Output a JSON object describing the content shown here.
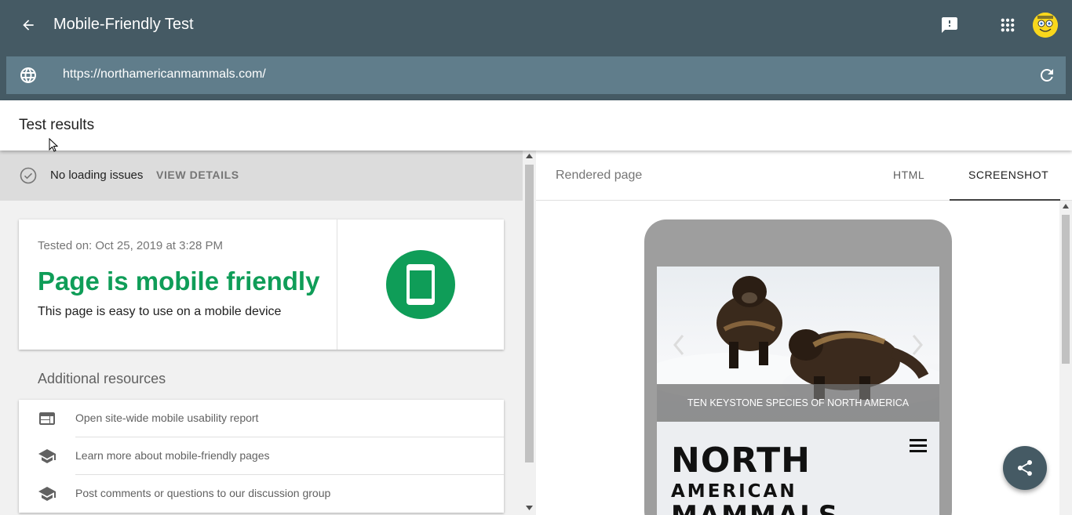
{
  "header": {
    "title": "Mobile-Friendly Test",
    "url": "https://northamericanmammals.com/",
    "icons": [
      "arrow-back-icon",
      "feedback-icon",
      "apps-grid-icon",
      "account-avatar",
      "globe-icon",
      "reload-icon"
    ]
  },
  "results": {
    "title": "Test results"
  },
  "loading": {
    "status": "No loading issues",
    "view_details": "VIEW DETAILS"
  },
  "card": {
    "tested_on": "Tested on: Oct 25, 2019 at 3:28 PM",
    "verdict": "Page is mobile friendly",
    "subtitle": "This page is easy to use on a mobile device",
    "accent": "#0f9d58"
  },
  "resources": {
    "title": "Additional resources",
    "items": [
      {
        "label": "Open site-wide mobile usability report",
        "icon": "web-icon"
      },
      {
        "label": "Learn more about mobile-friendly pages",
        "icon": "school-icon"
      },
      {
        "label": "Post comments or questions to our discussion group",
        "icon": "school-icon"
      }
    ]
  },
  "right": {
    "rendered_label": "Rendered page",
    "tab_html": "HTML",
    "tab_screenshot": "SCREENSHOT",
    "active_tab": "SCREENSHOT"
  },
  "preview": {
    "caption": "TEN KEYSTONE SPECIES OF NORTH AMERICA",
    "logo_line1": "NORTH",
    "logo_line2": "AMERICAN",
    "logo_line3": "MAMMALS"
  },
  "colors": {
    "appbar": "#455a64",
    "urlbar": "#607d8b",
    "success": "#0f9d58"
  }
}
